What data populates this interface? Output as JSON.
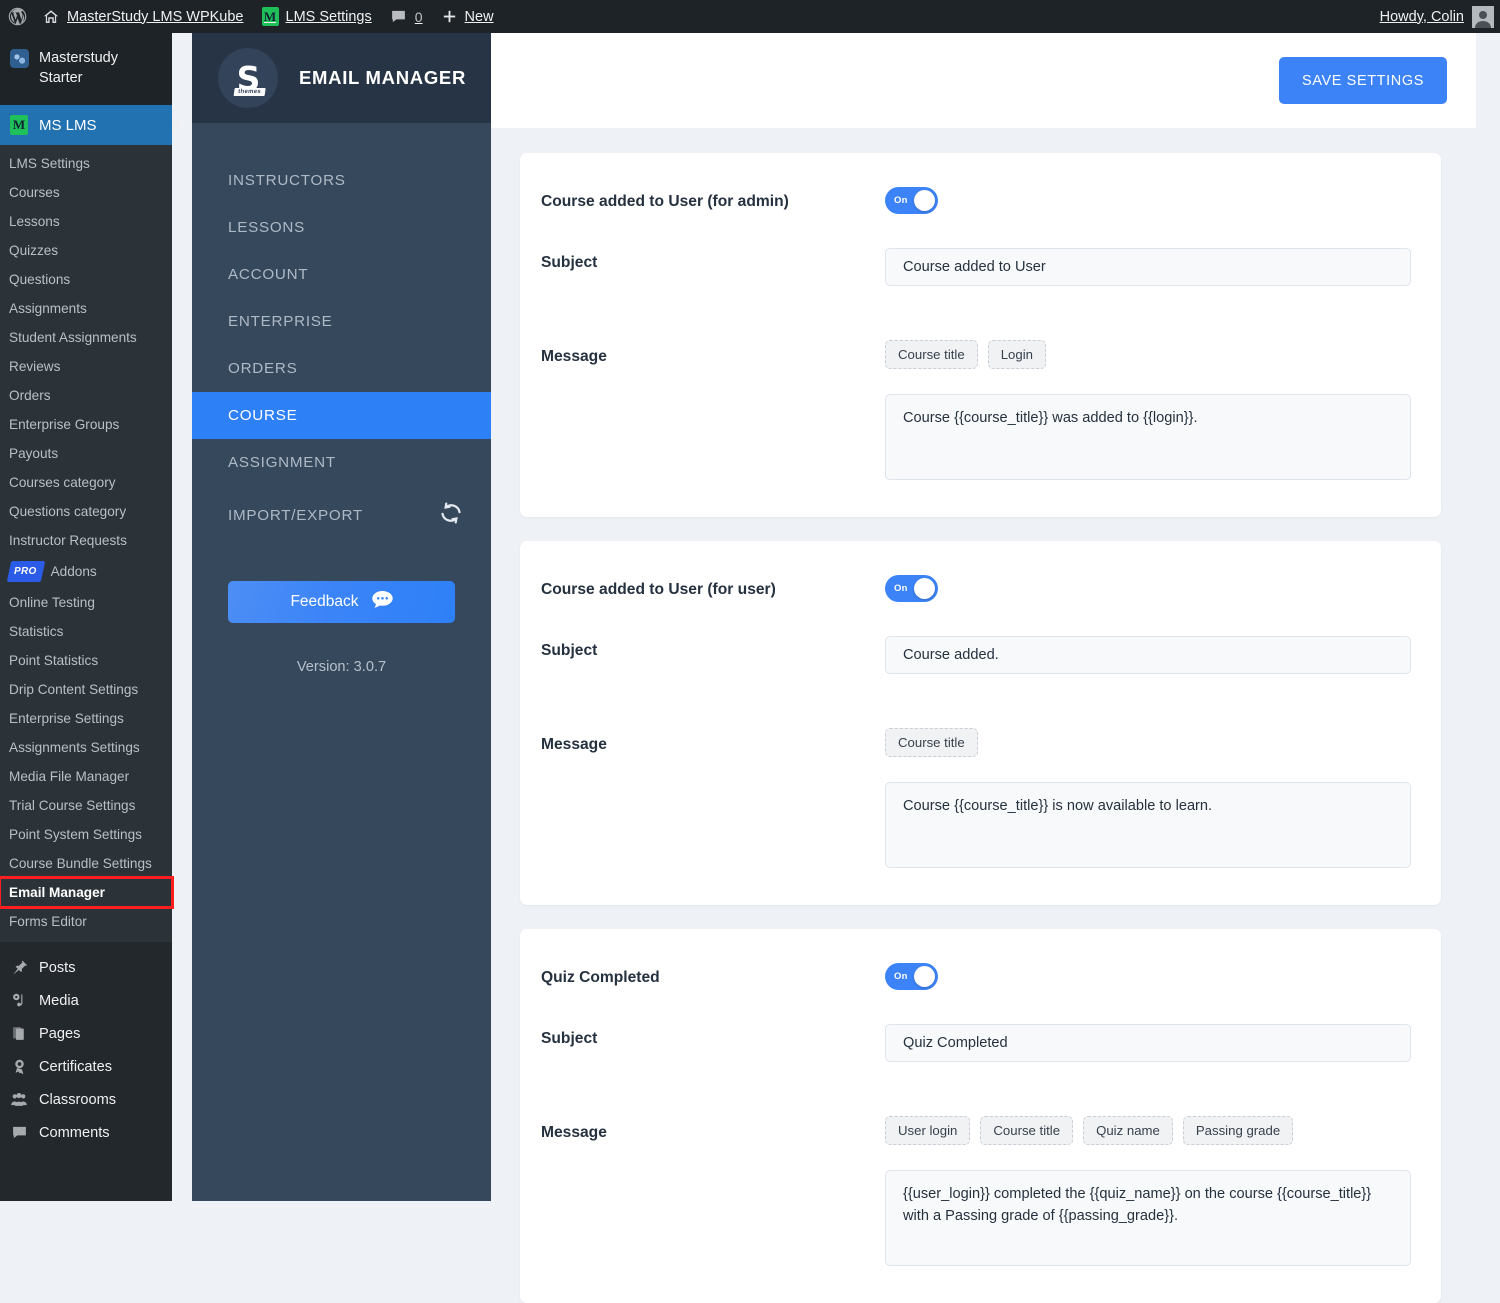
{
  "adminbar": {
    "wp_logo_icon": "wordpress-logo-icon",
    "site_home_icon": "home-icon",
    "site_name": "MasterStudy LMS WPKube",
    "lms_badge": "M",
    "lms_settings": "LMS Settings",
    "comments_icon": "comment-bubble-icon",
    "comments_count": "0",
    "new_icon": "plus-icon",
    "new_label": "New",
    "howdy": "Howdy, Colin",
    "avatar_icon": "avatar-icon"
  },
  "wpmenu": {
    "top": [
      {
        "label": "Masterstudy Starter",
        "icon": "masterstudy-logo-icon"
      }
    ],
    "active": {
      "label": "MS LMS",
      "icon": "ms-lms-badge-icon"
    },
    "submenu": [
      {
        "label": "LMS Settings"
      },
      {
        "label": "Courses"
      },
      {
        "label": "Lessons"
      },
      {
        "label": "Quizzes"
      },
      {
        "label": "Questions"
      },
      {
        "label": "Assignments"
      },
      {
        "label": "Student Assignments"
      },
      {
        "label": "Reviews"
      },
      {
        "label": "Orders"
      },
      {
        "label": "Enterprise Groups"
      },
      {
        "label": "Payouts"
      },
      {
        "label": "Courses category"
      },
      {
        "label": "Questions category"
      },
      {
        "label": "Instructor Requests"
      },
      {
        "label": "Addons",
        "badge": "PRO"
      },
      {
        "label": "Online Testing"
      },
      {
        "label": "Statistics"
      },
      {
        "label": "Point Statistics"
      },
      {
        "label": "Drip Content Settings"
      },
      {
        "label": "Enterprise Settings"
      },
      {
        "label": "Assignments Settings"
      },
      {
        "label": "Media File Manager"
      },
      {
        "label": "Trial Course Settings"
      },
      {
        "label": "Point System Settings"
      },
      {
        "label": "Course Bundle Settings"
      },
      {
        "label": "Email Manager",
        "highlighted": true
      },
      {
        "label": "Forms Editor"
      }
    ],
    "main": [
      {
        "label": "Posts",
        "icon": "pin-icon"
      },
      {
        "label": "Media",
        "icon": "media-icon"
      },
      {
        "label": "Pages",
        "icon": "pages-icon"
      },
      {
        "label": "Certificates",
        "icon": "award-icon"
      },
      {
        "label": "Classrooms",
        "icon": "group-icon"
      },
      {
        "label": "Comments",
        "icon": "comment-bubble-icon"
      }
    ]
  },
  "plugin": {
    "logo_icon": "stylemix-s-logo-icon",
    "logo_letter": "S",
    "logo_sub": "themes",
    "title": "EMAIL MANAGER",
    "nav": [
      {
        "label": "INSTRUCTORS",
        "active": false
      },
      {
        "label": "LESSONS",
        "active": false
      },
      {
        "label": "ACCOUNT",
        "active": false
      },
      {
        "label": "ENTERPRISE",
        "active": false
      },
      {
        "label": "ORDERS",
        "active": false
      },
      {
        "label": "COURSE",
        "active": true
      },
      {
        "label": "ASSIGNMENT",
        "active": false
      },
      {
        "label": "IMPORT/EXPORT",
        "active": false,
        "icon": "sync-refresh-icon"
      }
    ],
    "feedback_label": "Feedback",
    "feedback_icon": "chat-bubble-icon",
    "version": "Version: 3.0.7",
    "accent_color": "#2e80f7",
    "sidebar_color": "#36485c",
    "header_color": "#263445"
  },
  "header": {
    "save_label": "SAVE SETTINGS",
    "save_color": "#3b83f6"
  },
  "labels": {
    "subject": "Subject",
    "message": "Message",
    "toggle_on": "On"
  },
  "cards": [
    {
      "title": "Course added to User (for admin)",
      "enabled": true,
      "subject": "Course added to User",
      "tags": [
        "Course title",
        "Login"
      ],
      "message": "Course {{course_title}} was added to {{login}}."
    },
    {
      "title": "Course added to User (for user)",
      "enabled": true,
      "subject": "Course added.",
      "tags": [
        "Course title"
      ],
      "message": "Course {{course_title}} is now available to learn."
    },
    {
      "title": "Quiz Completed",
      "enabled": true,
      "subject": "Quiz Completed",
      "tags": [
        "User login",
        "Course title",
        "Quiz name",
        "Passing grade"
      ],
      "message": "{{user_login}} completed the {{quiz_name}} on the course {{course_title}} with a Passing grade of {{passing_grade}}."
    }
  ]
}
